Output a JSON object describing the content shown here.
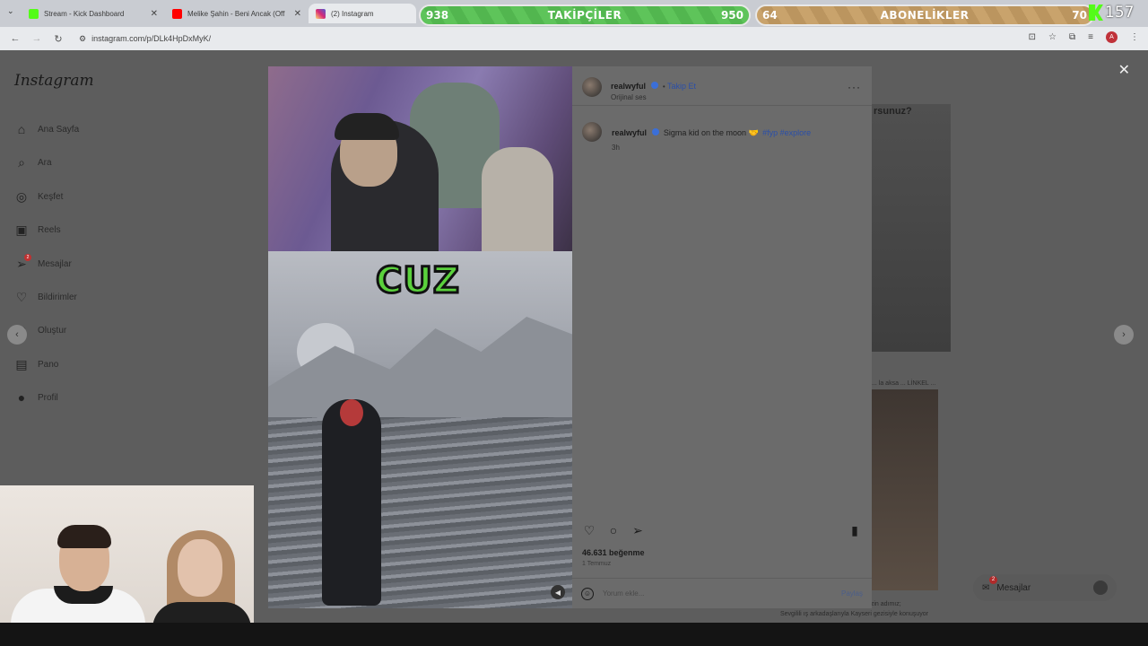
{
  "browser": {
    "tabs": [
      {
        "label": "Stream - Kick Dashboard",
        "favicon_color": "#53fc18"
      },
      {
        "label": "Melike Şahin - Beni Ancak (Off",
        "favicon_color": "#ff0000"
      },
      {
        "label": "(2) Instagram",
        "favicon_color": "#d62976"
      }
    ],
    "url": "instagram.com/p/DLk4HpDxMyK/",
    "profile_initial": "A"
  },
  "overlay": {
    "followers": {
      "current": "938",
      "label": "TAKİPÇİLER",
      "goal": "950"
    },
    "subs": {
      "current": "64",
      "label": "ABONELİKLER",
      "goal": "70"
    },
    "kick_viewers": "157"
  },
  "instagram": {
    "logo": "Instagram",
    "nav": [
      {
        "label": "Ana Sayfa",
        "icon": "home-icon"
      },
      {
        "label": "Ara",
        "icon": "search-icon"
      },
      {
        "label": "Keşfet",
        "icon": "compass-icon"
      },
      {
        "label": "Reels",
        "icon": "reels-icon"
      },
      {
        "label": "Mesajlar",
        "icon": "messenger-icon",
        "badge": "2"
      },
      {
        "label": "Bildirimler",
        "icon": "heart-icon"
      },
      {
        "label": "Oluştur",
        "icon": "plus-icon"
      },
      {
        "label": "Pano",
        "icon": "dashboard-icon"
      },
      {
        "label": "Profil",
        "icon": "avatar-icon"
      }
    ],
    "bg_text_top": "rsunuz?",
    "bg_caption_mid": "... la aksa ... LİNKEL ...",
    "bg_caption_bottom_1": "... sizin adımız;",
    "bg_caption_bottom_2": "Sevgilili ış arkadaşlarıyla Kayseri gezisiyle konuşuyor",
    "messages_pill": {
      "label": "Mesajlar",
      "badge": "2"
    }
  },
  "post": {
    "media_caption_overlay": "CUZ",
    "username": "realwyful",
    "follow_label": "Takip Et",
    "audio": "Orijinal ses",
    "caption_text": "Sigma kid on the moon 🤝",
    "caption_tags": "#fyp #explore",
    "caption_time": "3h",
    "likes": "46.631 beğenme",
    "date": "1 Temmuz",
    "comment_placeholder": "Yorum ekle...",
    "share_label": "Paylaş"
  }
}
